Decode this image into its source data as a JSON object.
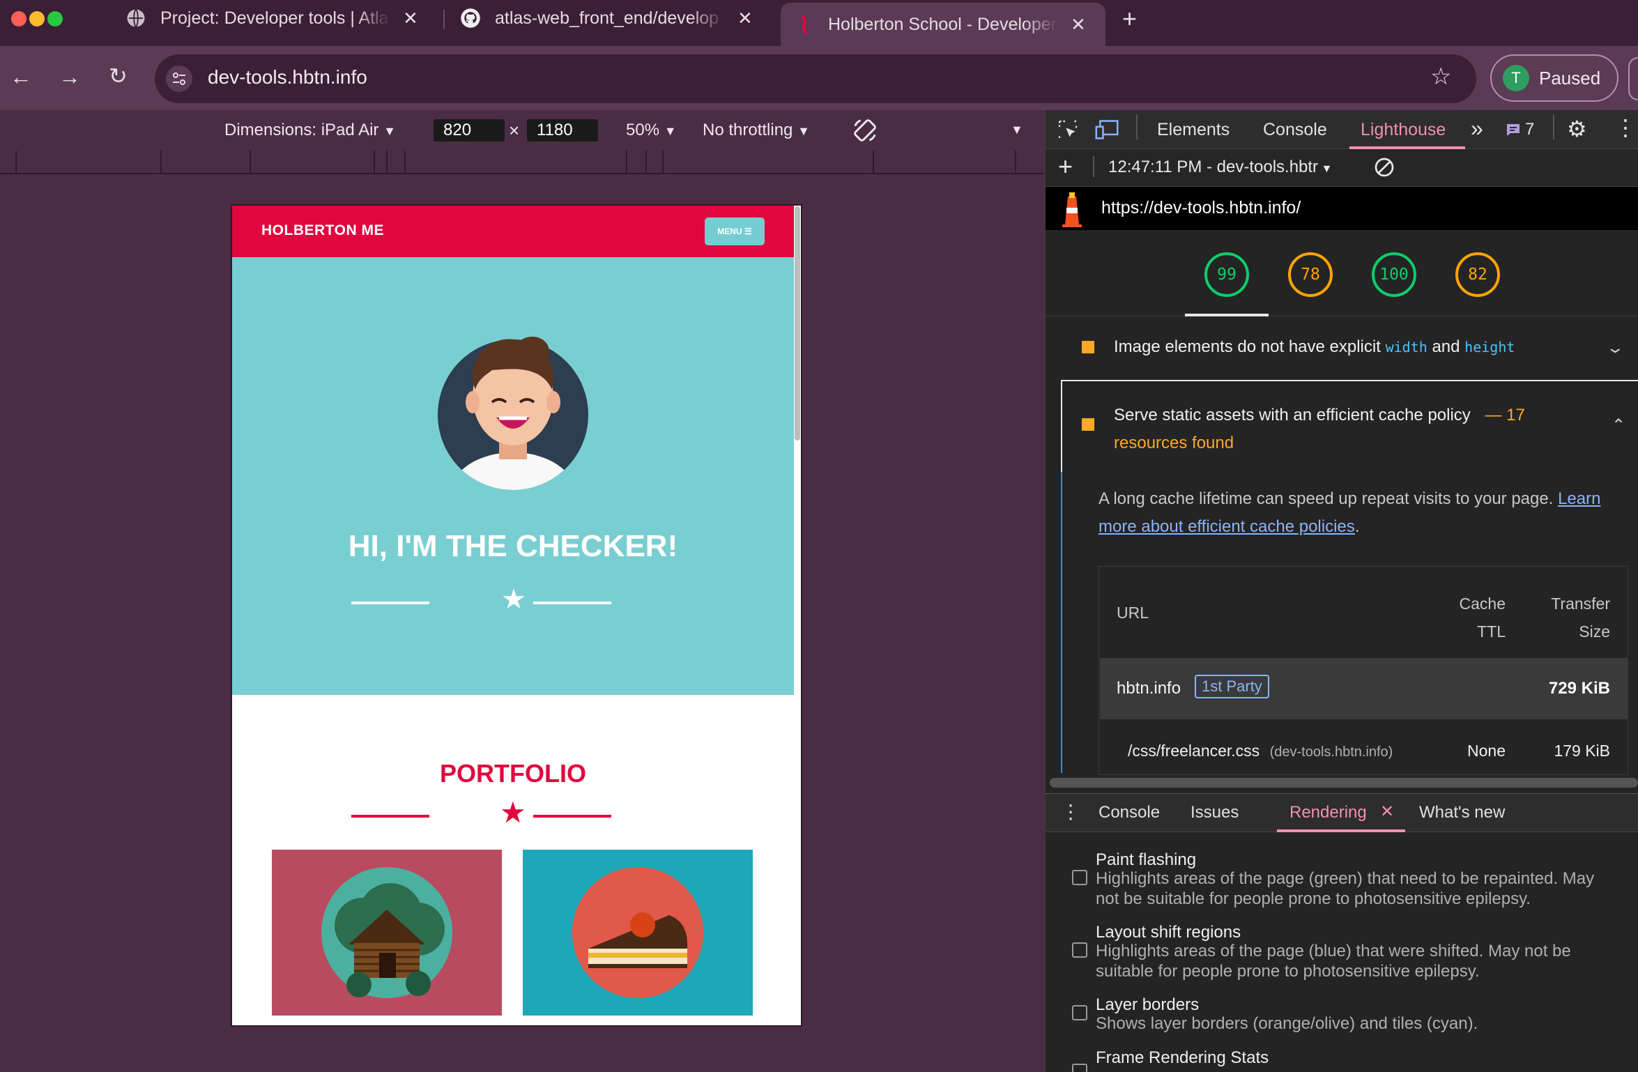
{
  "browser": {
    "tabs": [
      {
        "title": "Project: Developer tools | Atlas"
      },
      {
        "title": "atlas-web_front_end/develop"
      },
      {
        "title": "Holberton School - Developer"
      }
    ],
    "address": "dev-tools.hbtn.info",
    "profile_initial": "T",
    "profile_status": "Paused"
  },
  "device_toolbar": {
    "dimensions_label": "Dimensions: iPad Air",
    "width": "820",
    "height": "1180",
    "times": "×",
    "zoom": "50%",
    "throttling": "No throttling"
  },
  "site": {
    "brand": "HOLBERTON ME",
    "menu_label": "MENU ☰",
    "hero_title": "HI, I'M THE CHECKER!",
    "portfolio_title": "PORTFOLIO"
  },
  "devtools": {
    "tabs": [
      "Elements",
      "Console",
      "Lighthouse"
    ],
    "active_tab": "Lighthouse",
    "issues_count": "7",
    "report_time": "12:47:11 PM - dev-tools.hbtr",
    "report_url": "https://dev-tools.hbtn.info/",
    "scores": [
      "99",
      "78",
      "100",
      "82"
    ],
    "audit1": {
      "text": "Image elements do not have explicit",
      "code1": "width",
      "and": "and",
      "code2": "height"
    },
    "audit2": {
      "text": "Serve static assets with an efficient cache policy",
      "dash": "—",
      "count": "17",
      "found": "resources found"
    },
    "description": "A long cache lifetime can speed up repeat visits to your page.",
    "link_part1": "Learn",
    "link_part2": "more about efficient cache policies",
    "period": ".",
    "table": {
      "col_url": "URL",
      "col_cache_1": "Cache",
      "col_cache_2": "TTL",
      "col_size_1": "Transfer",
      "col_size_2": "Size",
      "group_host": "hbtn.info",
      "group_badge": "1st Party",
      "group_size": "729 KiB",
      "row_url": "/css/freelancer.css",
      "row_host": "(dev-tools.hbtn.info)",
      "row_ttl": "None",
      "row_size": "179 KiB"
    }
  },
  "drawer": {
    "tabs": [
      "Console",
      "Issues",
      "Rendering",
      "What's new"
    ],
    "active_tab": "Rendering",
    "options": [
      {
        "title": "Paint flashing",
        "desc1": "Highlights areas of the page (green) that need to be repainted. May",
        "desc2": "not be suitable for people prone to photosensitive epilepsy."
      },
      {
        "title": "Layout shift regions",
        "desc1": "Highlights areas of the page (blue) that were shifted. May not be",
        "desc2": "suitable for people prone to photosensitive epilepsy."
      },
      {
        "title": "Layer borders",
        "desc1": "Shows layer borders (orange/olive) and tiles (cyan).",
        "desc2": ""
      },
      {
        "title": "Frame Rendering Stats",
        "desc1": "",
        "desc2": ""
      }
    ]
  },
  "colors": {
    "accent": "#e1063e",
    "teal": "#79ced2",
    "lighthouse_active": "#f48fb1",
    "score_good": "#0cce6b",
    "score_average": "#ffa400"
  }
}
